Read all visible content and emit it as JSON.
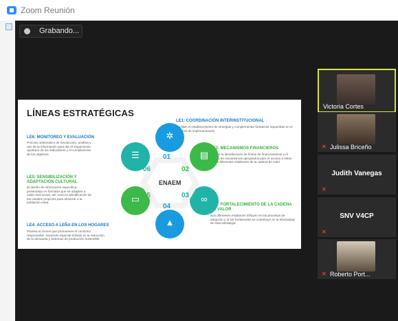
{
  "window": {
    "title": "Zoom Reunión"
  },
  "recording": {
    "label": "Grabando..."
  },
  "slide": {
    "title": "LÍNEAS ESTRATÉGICAS",
    "center_label": "ENAEM",
    "segments": [
      {
        "number": "01",
        "icon": "snowflake-icon"
      },
      {
        "number": "02",
        "icon": "money-icon"
      },
      {
        "number": "03",
        "icon": "link-icon"
      },
      {
        "number": "04",
        "icon": "campfire-icon"
      },
      {
        "number": "05",
        "icon": "presentation-icon"
      },
      {
        "number": "06",
        "icon": "checklist-icon"
      }
    ],
    "lines": [
      {
        "title": "LE1: COORDINACIÓN INTERINSTITUCIONAL",
        "body": "Facilitar el establecimiento de sinergias y complementar fortalezas requeridas en el proceso de implementación"
      },
      {
        "title": "LE2: MECANISMOS FINANCIEROS",
        "body": "Incluye la identificación de líneas de financiamiento y el diseño de mecanismos apropiados para el acceso a estos en los diferentes eslabones de la cadena de valor"
      },
      {
        "title": "LE3: FORTALECIMIENTO DE LA CADENA DE VALOR",
        "body": "Sus diferentes eslabones influyen en los procesos de adopción y al ser fortalecidos se contribuye en la efectividad de esta estrategia"
      },
      {
        "title": "LE4: ACCESO A LEÑA EN LOS HOGARES",
        "body": "Plantea acciones que promueven el consumo responsable, haciendo especial énfasis en la reducción de la demanda y sistemas de producción sostenible"
      },
      {
        "title": "LE5: SENSIBILIZACIÓN Y ADAPTACIÓN CULTURAL",
        "body": "El diseño de información específica presentada en formatos que se adapten a cada nivel social, así como la identificación de los canales propicios para alcanzar a la población meta."
      },
      {
        "title": "LE6: MONITOREO Y EVALUACIÓN",
        "body": "Proceso sistemático de recolección, análisis y uso de la información para dar el seguimiento oportuno de los indicadores y el cumplimiento de los objetivos"
      }
    ],
    "colors": {
      "blue": "#1a9be0",
      "green": "#3db94a",
      "teal": "#22b3a8"
    }
  },
  "participants": [
    {
      "name": "Victoria Cortes",
      "type": "video",
      "active": true
    },
    {
      "name": "Julissa Briceño",
      "type": "video",
      "muted": true
    },
    {
      "name": "Judith Vanegas",
      "type": "name",
      "muted": true
    },
    {
      "name": "SNV V4CP",
      "type": "name",
      "muted": true
    },
    {
      "name": "Roberto Port...",
      "type": "video",
      "muted": true
    }
  ]
}
